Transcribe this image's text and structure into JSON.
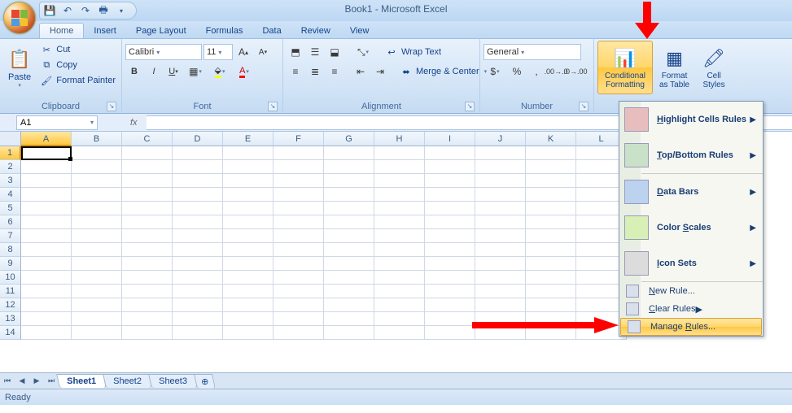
{
  "title": "Book1 - Microsoft Excel",
  "tabs": [
    "Home",
    "Insert",
    "Page Layout",
    "Formulas",
    "Data",
    "Review",
    "View"
  ],
  "active_tab": 0,
  "clipboard": {
    "label": "Clipboard",
    "paste": "Paste",
    "cut": "Cut",
    "copy": "Copy",
    "fp": "Format Painter"
  },
  "font": {
    "label": "Font",
    "name": "Calibri",
    "size": "11"
  },
  "alignment": {
    "label": "Alignment",
    "wrap": "Wrap Text",
    "merge": "Merge & Center"
  },
  "number": {
    "label": "Number",
    "format": "General"
  },
  "styles": {
    "cf": "Conditional\nFormatting",
    "fat": "Format\nas Table",
    "cs": "Cell\nStyles"
  },
  "namebox": "A1",
  "columns": [
    "A",
    "B",
    "C",
    "D",
    "E",
    "F",
    "G",
    "H",
    "I",
    "J",
    "K",
    "L"
  ],
  "rows": [
    "1",
    "2",
    "3",
    "4",
    "5",
    "6",
    "7",
    "8",
    "9",
    "10",
    "11",
    "12",
    "13",
    "14"
  ],
  "selected_col": 0,
  "selected_row": 0,
  "sheets": [
    "Sheet1",
    "Sheet2",
    "Sheet3"
  ],
  "active_sheet": 0,
  "status": "Ready",
  "cf_menu": {
    "big": [
      {
        "label": "Highlight Cells Rules",
        "u": "H",
        "color": "#e8bdbd"
      },
      {
        "label": "Top/Bottom Rules",
        "u": "T",
        "color": "#c9e1c9"
      },
      {
        "label": "Data Bars",
        "u": "D",
        "color": "#bcd3ef"
      },
      {
        "label": "Color Scales",
        "u": "S",
        "color": "#d8efb6"
      },
      {
        "label": "Icon Sets",
        "u": "I",
        "color": "#dcdcdc"
      }
    ],
    "small": [
      {
        "label": "New Rule...",
        "u": "N",
        "arrow": false
      },
      {
        "label": "Clear Rules",
        "u": "C",
        "arrow": true
      },
      {
        "label": "Manage Rules...",
        "u": "R",
        "arrow": false,
        "hl": true
      }
    ]
  }
}
